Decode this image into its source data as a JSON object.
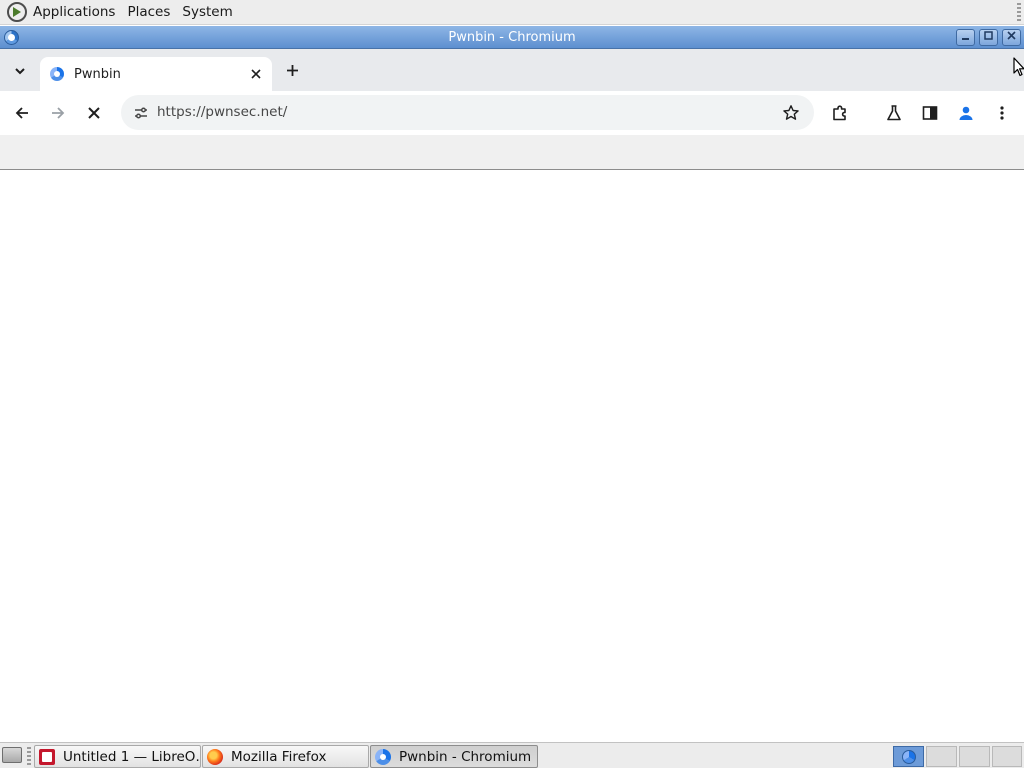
{
  "top_panel": {
    "menus": [
      "Applications",
      "Places",
      "System"
    ]
  },
  "window": {
    "title": "Pwnbin - Chromium"
  },
  "tabs": [
    {
      "title": "Pwnbin",
      "active": true
    }
  ],
  "toolbar": {
    "url": "https://pwnsec.net/",
    "loading": true
  },
  "taskbar": {
    "tasks": [
      {
        "label": "Untitled 1 — LibreO…",
        "icon": "libreoffice-icon"
      },
      {
        "label": "Mozilla Firefox",
        "icon": "firefox-icon"
      },
      {
        "label": "Pwnbin - Chromium",
        "icon": "chromium-icon",
        "active": true
      }
    ],
    "workspaces": 4,
    "current_workspace": 1
  },
  "colors": {
    "titlebar": "#5d8fd0",
    "tabstrip": "#e8eaed",
    "omnibox": "#f1f3f4",
    "profile_accent": "#1a73e8"
  }
}
